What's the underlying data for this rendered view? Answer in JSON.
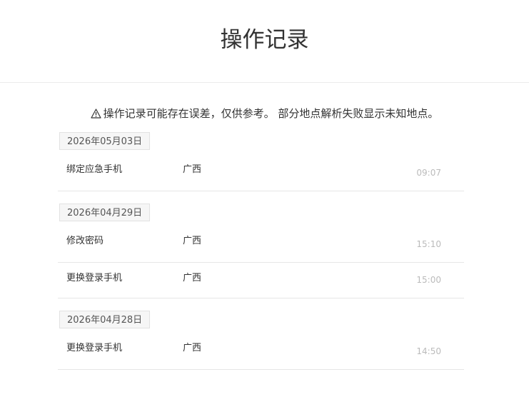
{
  "header": {
    "title": "操作记录"
  },
  "notice": {
    "icon": "warning-triangle-icon",
    "text": "操作记录可能存在误差，仅供参考。 部分地点解析失败显示未知地点。"
  },
  "groups": [
    {
      "date": "2026年05月03日",
      "records": [
        {
          "action": "绑定应急手机",
          "location": "广西",
          "time": "09:07"
        }
      ]
    },
    {
      "date": "2026年04月29日",
      "records": [
        {
          "action": "修改密码",
          "location": "广西",
          "time": "15:10"
        },
        {
          "action": "更换登录手机",
          "location": "广西",
          "time": "15:00"
        }
      ]
    },
    {
      "date": "2026年04月28日",
      "records": [
        {
          "action": "更换登录手机",
          "location": "广西",
          "time": "14:50"
        }
      ]
    }
  ]
}
